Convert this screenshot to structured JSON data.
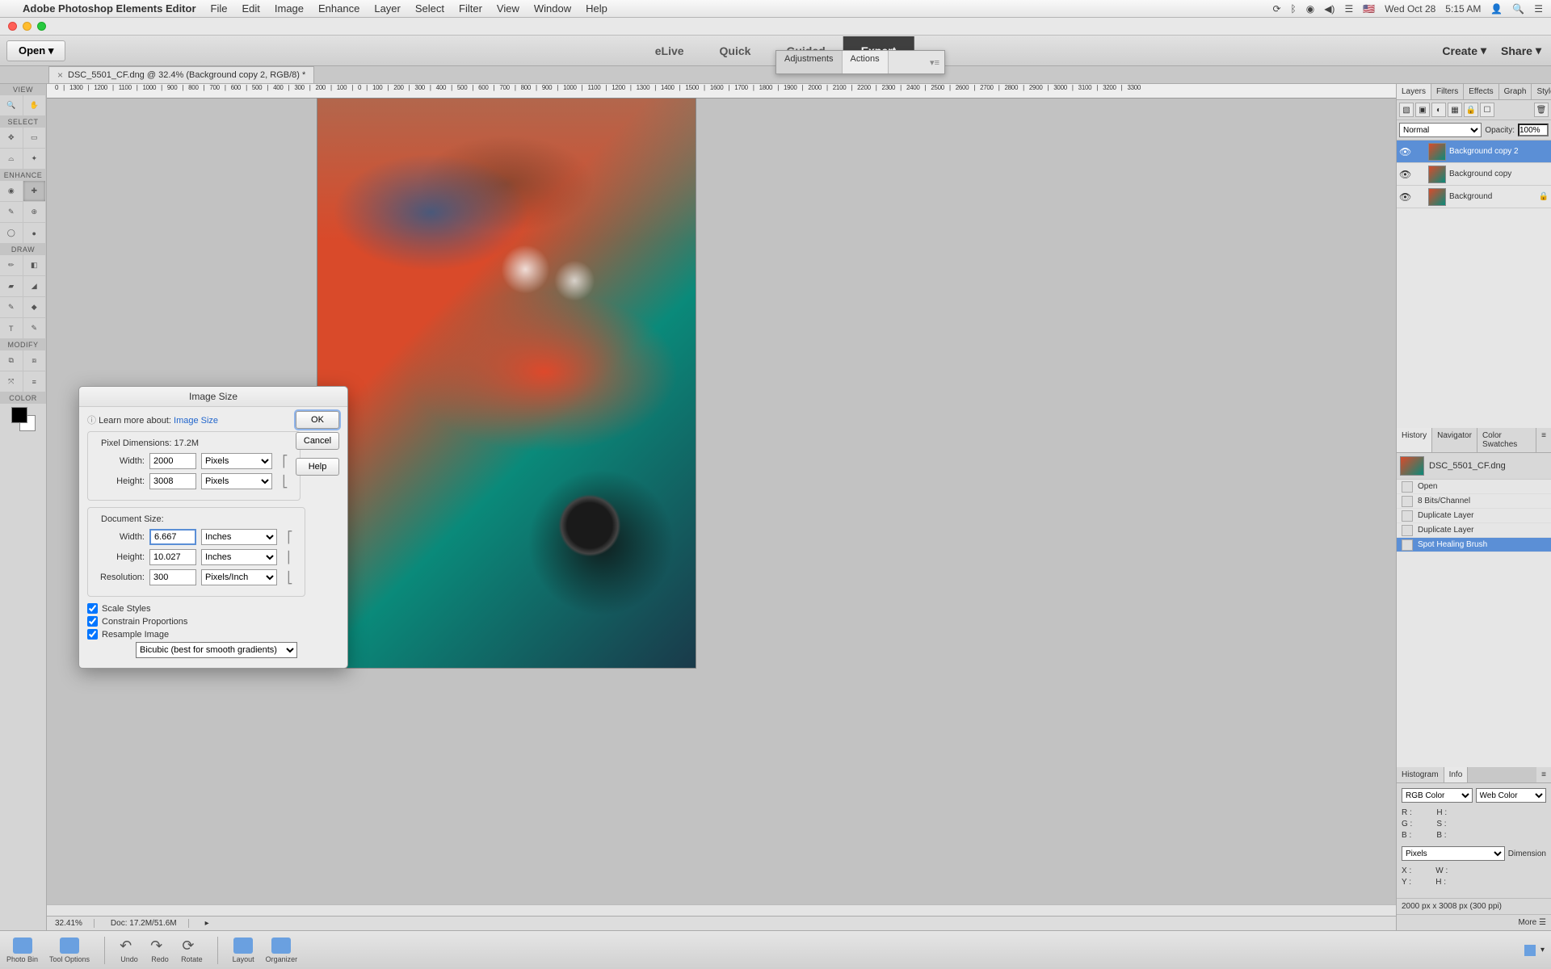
{
  "menubar": {
    "app": "Adobe Photoshop Elements Editor",
    "items": [
      "File",
      "Edit",
      "Image",
      "Enhance",
      "Layer",
      "Select",
      "Filter",
      "View",
      "Window",
      "Help"
    ],
    "right": {
      "flag": "🇺🇸",
      "date": "Wed Oct 28",
      "time": "5:15 AM"
    }
  },
  "topbar": {
    "open": "Open",
    "modes": [
      "eLive",
      "Quick",
      "Guided",
      "Expert"
    ],
    "active_mode": "Expert",
    "create": "Create",
    "share": "Share"
  },
  "float": {
    "tabs": [
      "Adjustments",
      "Actions"
    ]
  },
  "doc_tab": "DSC_5501_CF.dng @ 32.4% (Background copy 2, RGB/8) *",
  "ruler_ticks": [
    "0",
    "1300",
    "1200",
    "1100",
    "1000",
    "900",
    "800",
    "700",
    "600",
    "500",
    "400",
    "300",
    "200",
    "100",
    "0",
    "100",
    "200",
    "300",
    "400",
    "500",
    "600",
    "700",
    "800",
    "900",
    "1000",
    "1100",
    "1200",
    "1300",
    "1400",
    "1500",
    "1600",
    "1700",
    "1800",
    "1900",
    "2000",
    "2100",
    "2200",
    "2300",
    "2400",
    "2500",
    "2600",
    "2700",
    "2800",
    "2900",
    "3000",
    "3100",
    "3200",
    "3300"
  ],
  "status": {
    "zoom": "32.41%",
    "doc": "Doc: 17.2M/51.6M"
  },
  "tools": {
    "sections": [
      "VIEW",
      "SELECT",
      "ENHANCE",
      "DRAW",
      "MODIFY",
      "COLOR"
    ]
  },
  "layers_panel": {
    "tabs": [
      "Layers",
      "Filters",
      "Effects",
      "Graph",
      "Styles"
    ],
    "blend": "Normal",
    "opacity_label": "Opacity:",
    "opacity": "100%",
    "layers": [
      {
        "name": "Background copy 2",
        "sel": true
      },
      {
        "name": "Background copy",
        "sel": false
      },
      {
        "name": "Background",
        "sel": false,
        "locked": true
      }
    ]
  },
  "history_panel": {
    "tabs": [
      "History",
      "Navigator",
      "Color Swatches"
    ],
    "doc": "DSC_5501_CF.dng",
    "items": [
      {
        "name": "Open"
      },
      {
        "name": "8 Bits/Channel"
      },
      {
        "name": "Duplicate Layer"
      },
      {
        "name": "Duplicate Layer"
      },
      {
        "name": "Spot Healing Brush",
        "sel": true
      }
    ]
  },
  "info_panel": {
    "tabs": [
      "Histogram",
      "Info"
    ],
    "mode1": "RGB Color",
    "mode2": "Web Color",
    "r": "R :",
    "g": "G :",
    "b": "B :",
    "h": "H :",
    "s": "S :",
    "b2": "B :",
    "units": "Pixels",
    "dim_label": "Dimension",
    "x": "X :",
    "y": "Y :",
    "w": "W :",
    "hh": "H :",
    "footer": "2000 px x 3008 px (300 ppi)",
    "more": "More"
  },
  "bottom": {
    "items": [
      "Photo Bin",
      "Tool Options",
      "Undo",
      "Redo",
      "Rotate",
      "Layout",
      "Organizer"
    ]
  },
  "dialog": {
    "title": "Image Size",
    "learn": "Learn more about:",
    "learn_link": "Image Size",
    "ok": "OK",
    "cancel": "Cancel",
    "help": "Help",
    "pixel_dim": "Pixel Dimensions:",
    "pixel_size": "17.2M",
    "width_label": "Width:",
    "height_label": "Height:",
    "res_label": "Resolution:",
    "px_width": "2000",
    "px_height": "3008",
    "px_unit": "Pixels",
    "doc_size": "Document Size:",
    "doc_width": "6.667",
    "doc_height": "10.027",
    "doc_unit": "Inches",
    "resolution": "300",
    "res_unit": "Pixels/Inch",
    "scale": "Scale Styles",
    "constrain": "Constrain Proportions",
    "resample": "Resample Image",
    "method": "Bicubic (best for smooth gradients)"
  }
}
